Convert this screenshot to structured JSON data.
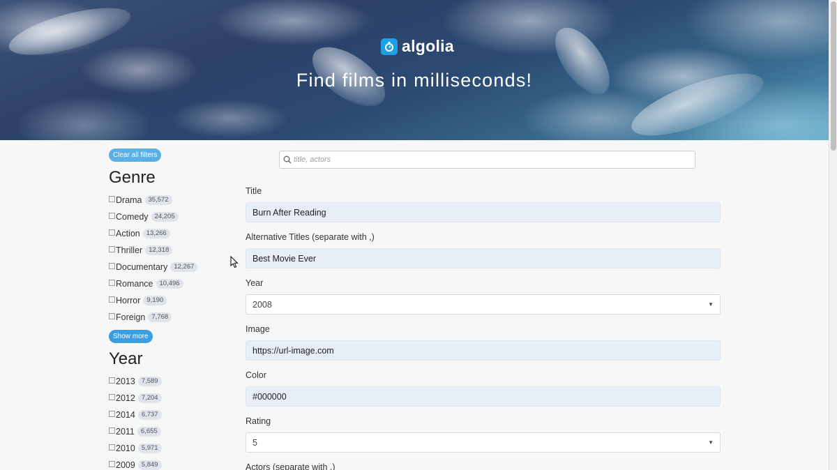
{
  "hero": {
    "brand": "algolia",
    "title": "Find films in milliseconds!"
  },
  "sidebar": {
    "clear_label": "Clear all filters",
    "genre": {
      "title": "Genre",
      "items": [
        {
          "label": "Drama",
          "count": "35,572"
        },
        {
          "label": "Comedy",
          "count": "24,205"
        },
        {
          "label": "Action",
          "count": "13,266"
        },
        {
          "label": "Thriller",
          "count": "12,318"
        },
        {
          "label": "Documentary",
          "count": "12,267"
        },
        {
          "label": "Romance",
          "count": "10,496"
        },
        {
          "label": "Horror",
          "count": "9,190"
        },
        {
          "label": "Foreign",
          "count": "7,768"
        }
      ],
      "show_more_label": "Show more"
    },
    "year": {
      "title": "Year",
      "items": [
        {
          "label": "2013",
          "count": "7,589"
        },
        {
          "label": "2012",
          "count": "7,204"
        },
        {
          "label": "2014",
          "count": "6,737"
        },
        {
          "label": "2011",
          "count": "6,655"
        },
        {
          "label": "2010",
          "count": "5,971"
        },
        {
          "label": "2009",
          "count": "5,849"
        }
      ]
    }
  },
  "search": {
    "placeholder": "title, actors",
    "value": ""
  },
  "form": {
    "title": {
      "label": "Title",
      "value": "Burn After Reading"
    },
    "alt_titles": {
      "label": "Alternative Titles (separate with ,)",
      "value": "Best Movie Ever"
    },
    "year": {
      "label": "Year",
      "value": "2008"
    },
    "image": {
      "label": "Image",
      "value": "https://url-image.com"
    },
    "color": {
      "label": "Color",
      "value": "#000000"
    },
    "rating": {
      "label": "Rating",
      "value": "5"
    },
    "actors": {
      "label": "Actors (separate with ,)"
    }
  },
  "colors": {
    "accent": "#3a9ee0",
    "brand": "#1ea0e6",
    "input_fill": "#e7eef7"
  }
}
